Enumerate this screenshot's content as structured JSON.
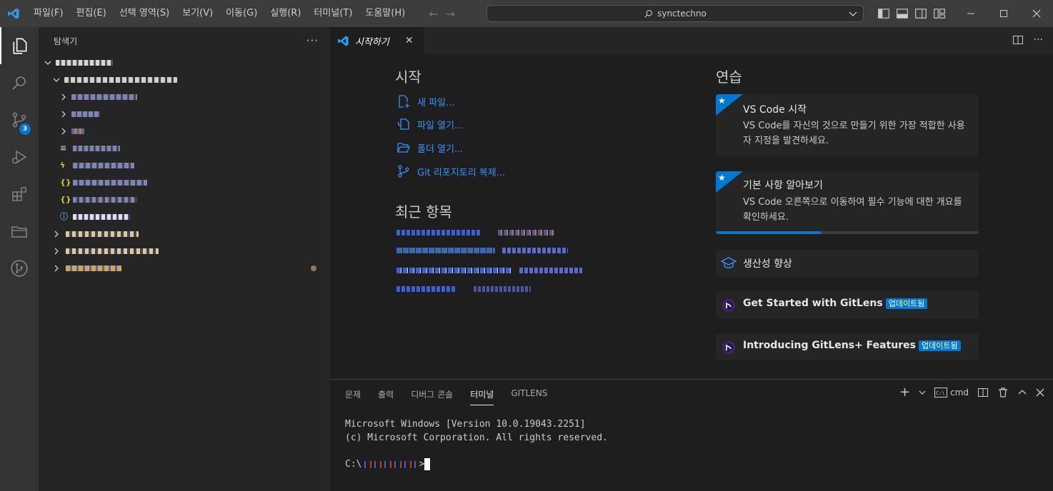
{
  "window": {
    "menu": [
      "파일(F)",
      "편집(E)",
      "선택 영역(S)",
      "보기(V)",
      "이동(G)",
      "실행(R)",
      "터미널(T)",
      "도움말(H)"
    ],
    "search_text": "synctechno"
  },
  "sidebar": {
    "title": "탐색기",
    "more": "···"
  },
  "tabs": {
    "welcome_label": "시작하기",
    "close": "✕"
  },
  "welcome": {
    "start_title": "시작",
    "start_links": [
      "새 파일...",
      "파일 열기...",
      "폴더 열기...",
      "Git 리포지토리 복제..."
    ],
    "recent_title": "최근 항목",
    "walkthrough_title": "연습",
    "cards": [
      {
        "title": "VS Code 시작",
        "desc": "VS Code를 자신의 것으로 만들기 위한 가장 적합한 사용자 지정을 발견하세요."
      },
      {
        "title": "기본 사항 알아보기",
        "desc": "VS Code 오른쪽으로 이동하여 필수 기능에 대한 개요를 확인하세요.",
        "progress": 0.4
      },
      {
        "title": "생산성 향상"
      },
      {
        "title": "Get Started with GitLens",
        "badge": "업데이트됨"
      },
      {
        "title": "Introducing GitLens+ Features",
        "badge": "업데이트됨"
      }
    ]
  },
  "panel": {
    "tabs": [
      "문제",
      "출력",
      "디버그 콘솔",
      "터미널",
      "GITLENS"
    ],
    "active_tab": "터미널",
    "shell": "cmd",
    "terminal_lines": [
      "Microsoft Windows [Version 10.0.19043.2251]",
      "(c) Microsoft Corporation. All rights reserved."
    ],
    "prompt_prefix": "C:\\",
    "prompt_suffix": ">"
  },
  "activity": {
    "source_control_badge": "3"
  },
  "colors": {
    "accent": "#0078d4",
    "link": "#3794ff",
    "titlebar": "#3c3c3c",
    "activitybar": "#333333",
    "sidebar": "#252526",
    "editor": "#1e1e1e"
  }
}
